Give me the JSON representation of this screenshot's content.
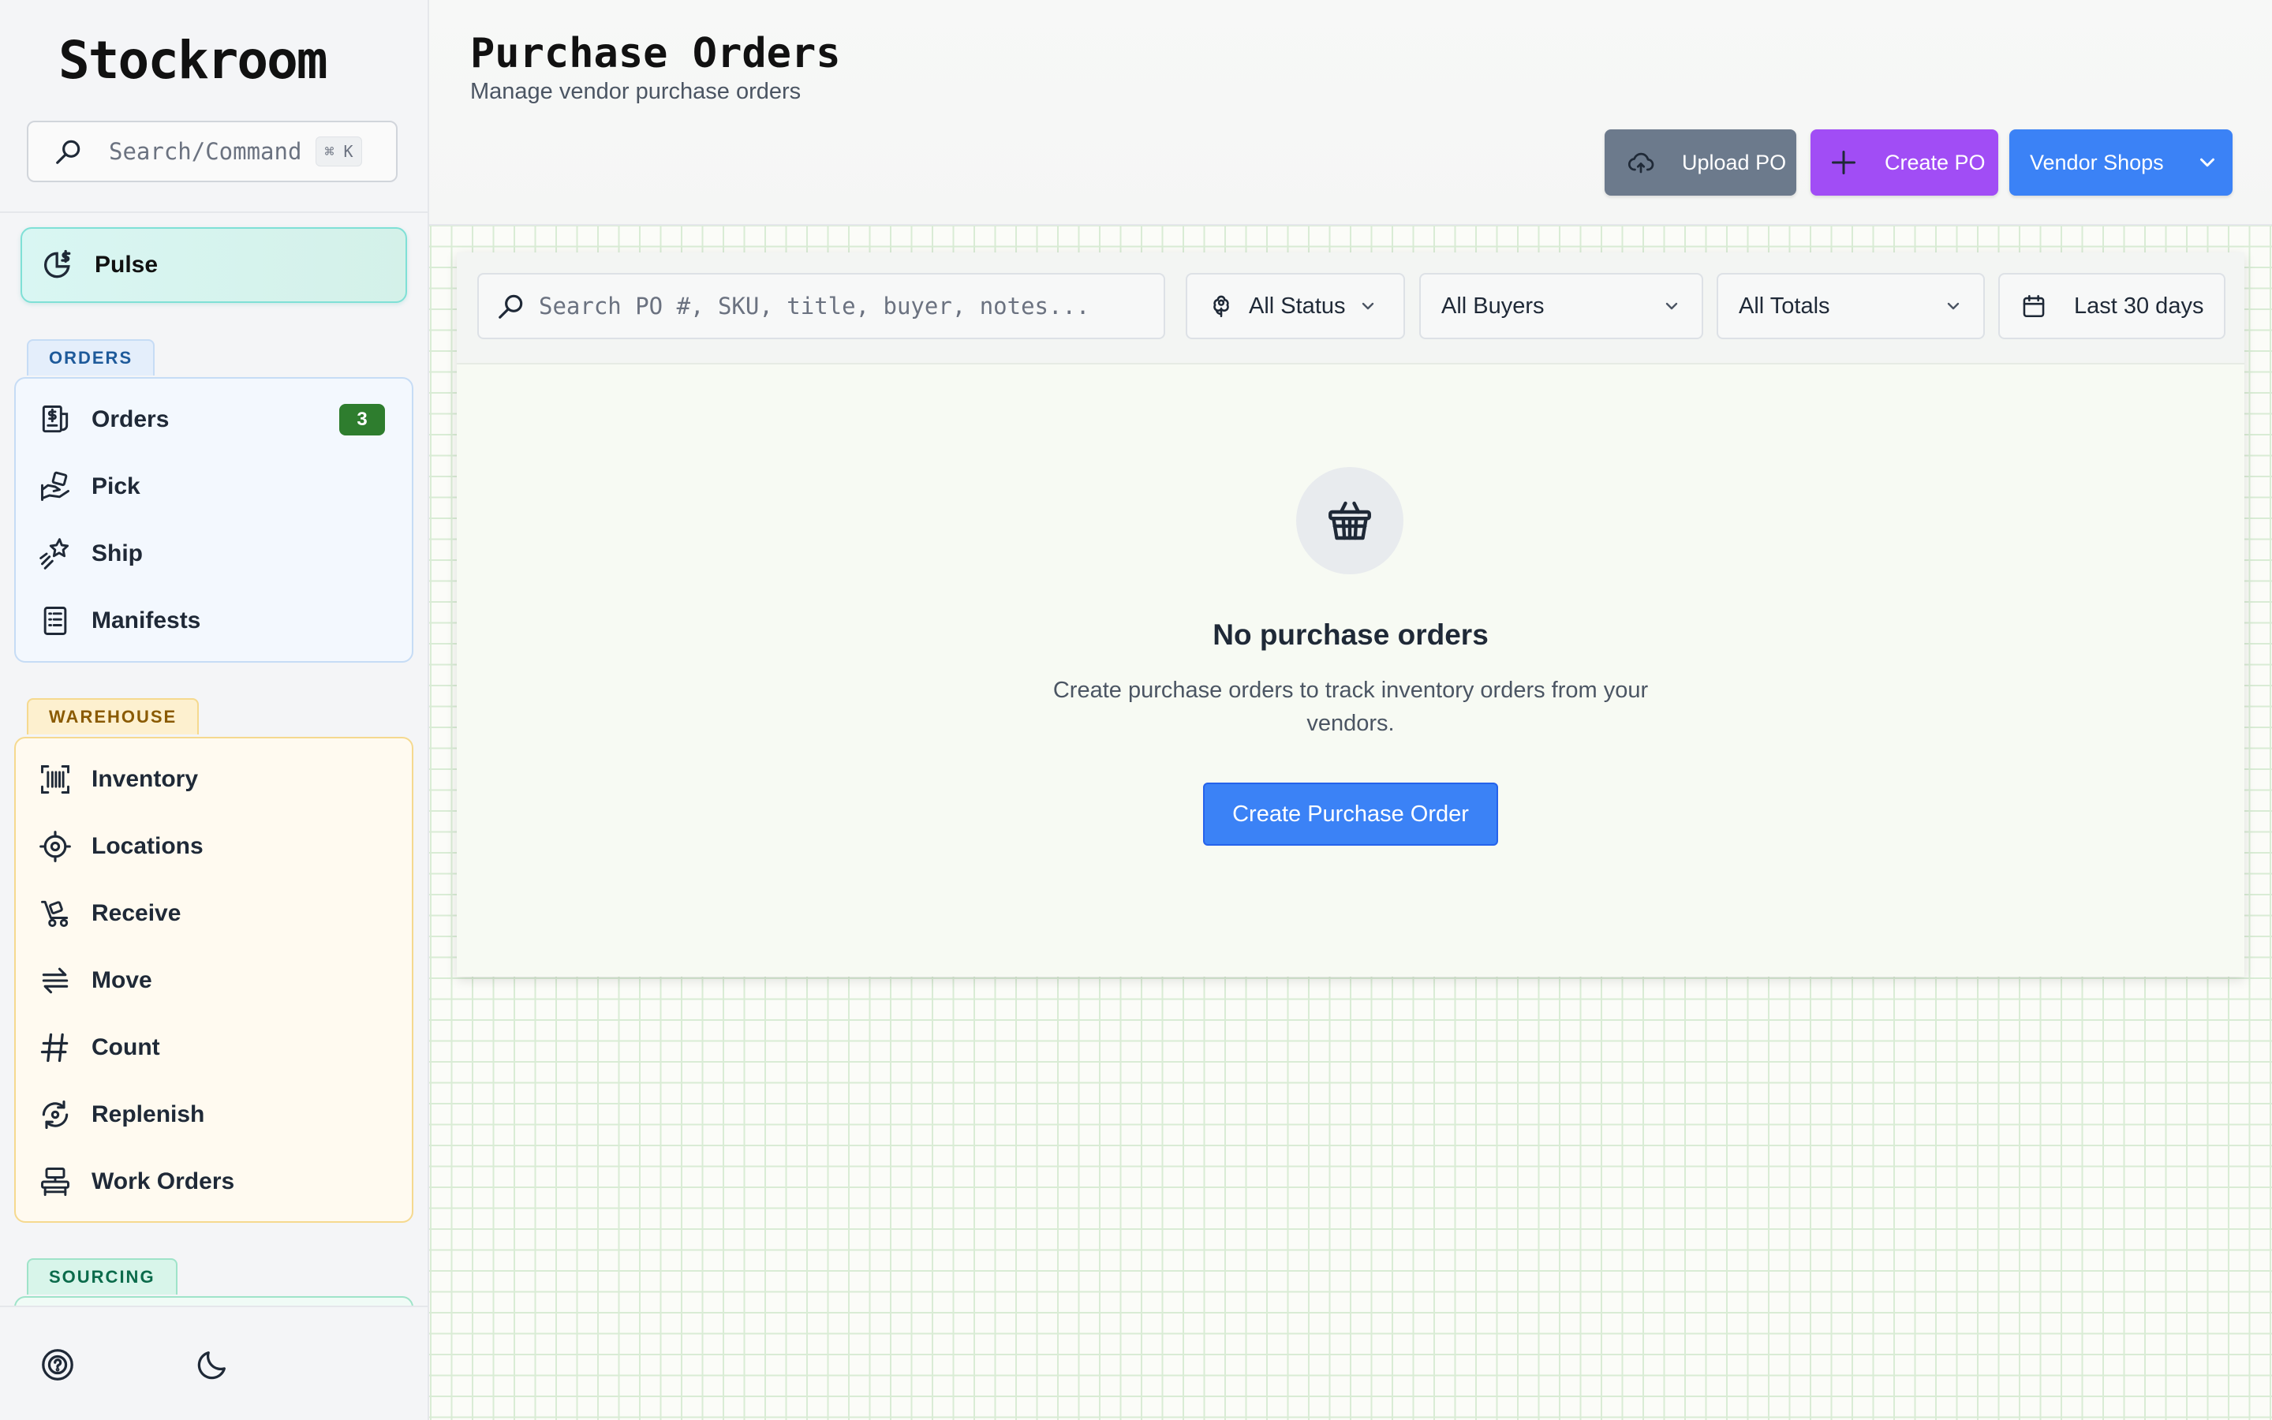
{
  "app": {
    "logo": "Stockroom"
  },
  "sidebar": {
    "search": {
      "placeholder": "Search/Command",
      "shortcut": "⌘ K"
    },
    "pulse": {
      "label": "Pulse",
      "icon": "pie-chart-dollar-icon"
    },
    "sections": [
      {
        "tag": "ORDERS",
        "items": [
          {
            "label": "Orders",
            "icon": "dollar-receipt-icon",
            "badge": "3"
          },
          {
            "label": "Pick",
            "icon": "hand-box-icon"
          },
          {
            "label": "Ship",
            "icon": "shooting-star-icon"
          },
          {
            "label": "Manifests",
            "icon": "document-list-icon"
          }
        ]
      },
      {
        "tag": "WAREHOUSE",
        "items": [
          {
            "label": "Inventory",
            "icon": "barcode-scan-icon"
          },
          {
            "label": "Locations",
            "icon": "crosshair-icon"
          },
          {
            "label": "Receive",
            "icon": "dolly-icon"
          },
          {
            "label": "Move",
            "icon": "arrows-transfer-icon"
          },
          {
            "label": "Count",
            "icon": "hash-icon"
          },
          {
            "label": "Replenish",
            "icon": "refresh-icon"
          },
          {
            "label": "Work Orders",
            "icon": "workbench-icon"
          }
        ]
      },
      {
        "tag": "SOURCING",
        "items": []
      }
    ],
    "footer": {
      "help_icon": "help-circle-icon",
      "theme_icon": "moon-icon"
    }
  },
  "header": {
    "title": "Purchase Orders",
    "subtitle": "Manage vendor purchase orders",
    "buttons": {
      "upload": {
        "label": "Upload PO",
        "icon": "cloud-upload-icon"
      },
      "create": {
        "label": "Create PO",
        "icon": "plus-icon"
      },
      "vendor": {
        "label": "Vendor Shops",
        "icon": "chevron-down-icon"
      }
    }
  },
  "filters": {
    "search_placeholder": "Search PO #, SKU, title, buyer, notes...",
    "status": "All Status",
    "buyers": "All Buyers",
    "totals": "All Totals",
    "date": "Last 30 days"
  },
  "empty_state": {
    "icon": "basket-icon",
    "title": "No purchase orders",
    "description": "Create purchase orders to track inventory orders from your vendors.",
    "button": "Create Purchase Order"
  },
  "colors": {
    "primary": "#3b82f6",
    "create_purple": "#a14df5",
    "upload_gray": "#6c7a8c",
    "badge_green": "#2e7d2e",
    "pulse_teal": "#d9f6f3"
  }
}
